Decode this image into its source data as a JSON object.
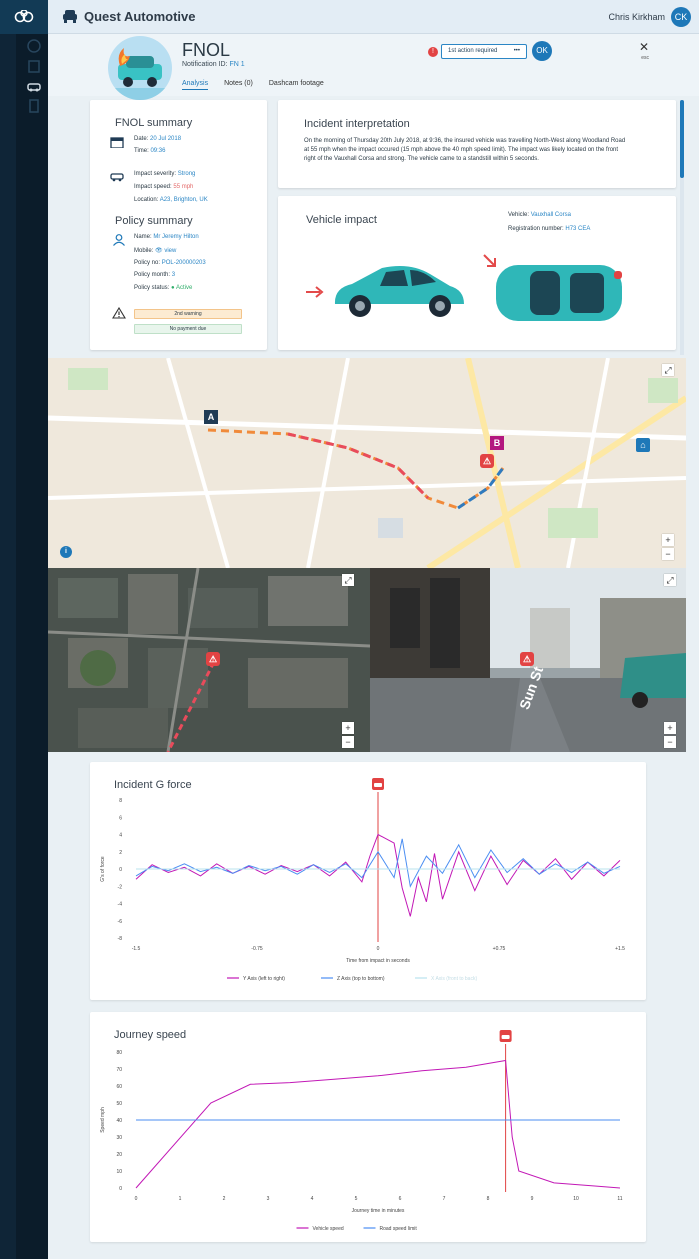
{
  "app": {
    "title": "Quest Automotive",
    "user_name": "Chris Kirkham",
    "user_initials": "CK"
  },
  "header": {
    "title": "FNOL",
    "notification_label": "Notification ID:",
    "notification_id": "FN 1",
    "tabs": [
      "Analysis",
      "Notes (0)",
      "Dashcam footage"
    ],
    "action_select": "1st action required",
    "alert_count": "!",
    "ok_label": "OK",
    "close_label": "esc"
  },
  "fnol_summary": {
    "title": "FNOL summary",
    "date_label": "Date:",
    "date": "20 Jul 2018",
    "time_label": "Time:",
    "time": "09:36",
    "severity_label": "Impact severity:",
    "severity": "Strong",
    "speed_label": "Impact speed:",
    "speed": "55 mph",
    "location_label": "Location:",
    "location": "A23, Brighton, UK"
  },
  "policy_summary": {
    "title": "Policy summary",
    "name_label": "Name:",
    "name": "Mr Jeremy Hilton",
    "mobile_label": "Mobile:",
    "mobile": "view",
    "policy_no_label": "Policy no:",
    "policy_no": "POL-200000203",
    "policy_month_label": "Policy month:",
    "policy_month": "3",
    "policy_status_label": "Policy status:",
    "policy_status": "Active",
    "warning": "2nd warning",
    "payment": "No payment due"
  },
  "incident": {
    "title": "Incident interpretation",
    "text": "On the morning of Thursday 20th July 2018, at 9:36, the insured vehicle was travelling North-West along Woodland Road at 55 mph when the impact occured (15 mph above the 40 mph speed limit). The impact was likely located on the front right of the Vauxhall Corsa and strong. The vehicle came to a standstill within 5 seconds."
  },
  "vehicle_impact": {
    "title": "Vehicle impact",
    "vehicle_label": "Vehicle:",
    "vehicle": "Vauxhall Corsa",
    "reg_label": "Registration number:",
    "reg": "H73 CEA"
  },
  "map": {
    "start_label": "A",
    "end_label": "B",
    "info": "i",
    "zoom_in": "+",
    "zoom_out": "−"
  },
  "street_sign": "Sun St",
  "colors": {
    "primary": "#1e78b8",
    "alert": "#e24343",
    "y_axis": "#c218b6",
    "z_axis": "#4b8ef2",
    "x_axis": "#b9e3ee",
    "limit": "#4b8ef2"
  },
  "chart_data": [
    {
      "type": "line",
      "title": "Incident G force",
      "xlabel": "Time from impact in seconds",
      "ylabel": "G's of force",
      "xlim": [
        -1.5,
        1.5
      ],
      "ylim": [
        -8,
        8
      ],
      "xticks": [
        "-1.5",
        "-0.75",
        "0",
        "+0.75",
        "+1.5"
      ],
      "yticks": [
        "8",
        "6",
        "4",
        "2",
        "0",
        "-2",
        "-4",
        "-6",
        "-8"
      ],
      "impact_x": 0,
      "series": [
        {
          "name": "Y Axis (left to right)",
          "x": [
            -1.5,
            -1.4,
            -1.3,
            -1.2,
            -1.1,
            -1.0,
            -0.9,
            -0.8,
            -0.7,
            -0.6,
            -0.5,
            -0.4,
            -0.3,
            -0.2,
            -0.1,
            -0.05,
            0,
            0.1,
            0.15,
            0.2,
            0.25,
            0.3,
            0.35,
            0.4,
            0.5,
            0.6,
            0.7,
            0.8,
            0.9,
            1.0,
            1.1,
            1.2,
            1.3,
            1.4,
            1.5
          ],
          "values": [
            -1.2,
            0.5,
            -0.4,
            0.2,
            -0.8,
            0.6,
            -0.5,
            0.3,
            -0.6,
            0.4,
            -0.3,
            0.5,
            -0.8,
            0.8,
            -1.5,
            1.5,
            4.0,
            3.0,
            -2.2,
            -5.5,
            -1.0,
            -3.8,
            1.8,
            -3.5,
            2.0,
            -2.5,
            1.5,
            -1.8,
            1.0,
            -0.6,
            1.2,
            -1.2,
            0.8,
            -0.8,
            1.0
          ]
        },
        {
          "name": "Z Axis (top to bottom)",
          "x": [
            -1.5,
            -1.4,
            -1.3,
            -1.2,
            -1.1,
            -1.0,
            -0.9,
            -0.8,
            -0.7,
            -0.6,
            -0.5,
            -0.4,
            -0.3,
            -0.2,
            -0.1,
            0,
            0.1,
            0.15,
            0.2,
            0.3,
            0.4,
            0.5,
            0.6,
            0.7,
            0.8,
            0.9,
            1.0,
            1.1,
            1.2,
            1.3,
            1.4,
            1.5
          ],
          "values": [
            -0.8,
            0.3,
            -0.2,
            0.6,
            -0.3,
            0.2,
            -0.5,
            0.4,
            -0.2,
            0.3,
            -0.6,
            0.5,
            -0.4,
            0.6,
            -1.0,
            2.0,
            -1.0,
            3.5,
            -2.0,
            1.5,
            -0.5,
            2.8,
            -1.0,
            2.2,
            -0.4,
            1.2,
            -0.6,
            0.6,
            -0.4,
            0.8,
            -0.5,
            0.3
          ]
        },
        {
          "name": "X Axis (front to back)",
          "x": [
            -1.5,
            1.5
          ],
          "values": [
            0,
            0
          ]
        }
      ]
    },
    {
      "type": "line",
      "title": "Journey speed",
      "xlabel": "Journey time in minutes",
      "ylabel": "Speed mph",
      "xlim": [
        0,
        11
      ],
      "ylim": [
        0,
        80
      ],
      "xticks": [
        "0",
        "1",
        "2",
        "3",
        "4",
        "5",
        "6",
        "7",
        "8",
        "9",
        "10",
        "11"
      ],
      "yticks": [
        "80",
        "70",
        "60",
        "50",
        "40",
        "30",
        "20",
        "10",
        "0"
      ],
      "impact_x": 8.4,
      "series": [
        {
          "name": "Vehicle speed",
          "x": [
            0,
            1.7,
            2.6,
            3.5,
            4.5,
            5.5,
            6.5,
            7.5,
            8.4,
            8.55,
            8.7,
            9.5,
            10.5,
            11
          ],
          "values": [
            0,
            50,
            61,
            62,
            64,
            66,
            69,
            71,
            75,
            30,
            10,
            3,
            1,
            0
          ]
        },
        {
          "name": "Road speed limit",
          "x": [
            0,
            11
          ],
          "values": [
            40,
            40
          ]
        }
      ]
    }
  ]
}
